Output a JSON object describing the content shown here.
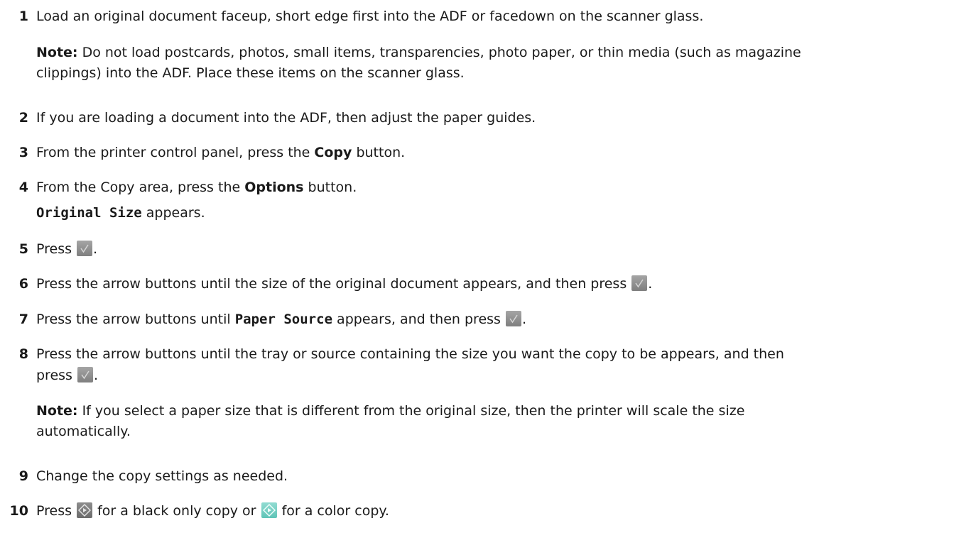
{
  "steps": [
    {
      "num": "1",
      "text": "Load an original document faceup, short edge first into the ADF or facedown on the scanner glass."
    },
    {
      "num": "2",
      "text": "If you are loading a document into the ADF, then adjust the paper guides."
    },
    {
      "num": "3",
      "pre": "From the printer control panel, press the ",
      "bold": "Copy",
      "post": " button."
    },
    {
      "num": "4",
      "pre": "From the Copy area, press the ",
      "bold": "Options",
      "post": " button."
    },
    {
      "num": "5",
      "pre": "Press ",
      "post": "."
    },
    {
      "num": "6",
      "pre": "Press the arrow buttons until the size of the original document appears, and then press ",
      "post": "."
    },
    {
      "num": "7",
      "pre": "Press the arrow buttons until ",
      "mono": "Paper Source",
      "mid": " appears, and then press ",
      "post": "."
    },
    {
      "num": "8",
      "line1": "Press the arrow buttons until the tray or source containing the size you want the copy to be appears, and then",
      "line2_pre": "press ",
      "line2_post": "."
    },
    {
      "num": "9",
      "text": "Change the copy settings as needed."
    },
    {
      "num": "10",
      "pre": "Press ",
      "mid": " for a black only copy or ",
      "post": " for a color copy."
    }
  ],
  "step4_sub": {
    "mono": "Original Size",
    "post": " appears."
  },
  "note1": {
    "label": "Note:",
    "line1": " Do not load postcards, photos, small items, transparencies, photo paper, or thin media (such as magazine",
    "line2": "clippings) into the ADF. Place these items on the scanner glass."
  },
  "note2": {
    "label": "Note:",
    "line1": " If you select a paper size that is different from the original size, then the printer will scale the size",
    "line2": "automatically."
  },
  "icons": {
    "check": "check-button-icon",
    "start_black": "start-black-icon",
    "start_color": "start-color-icon"
  }
}
